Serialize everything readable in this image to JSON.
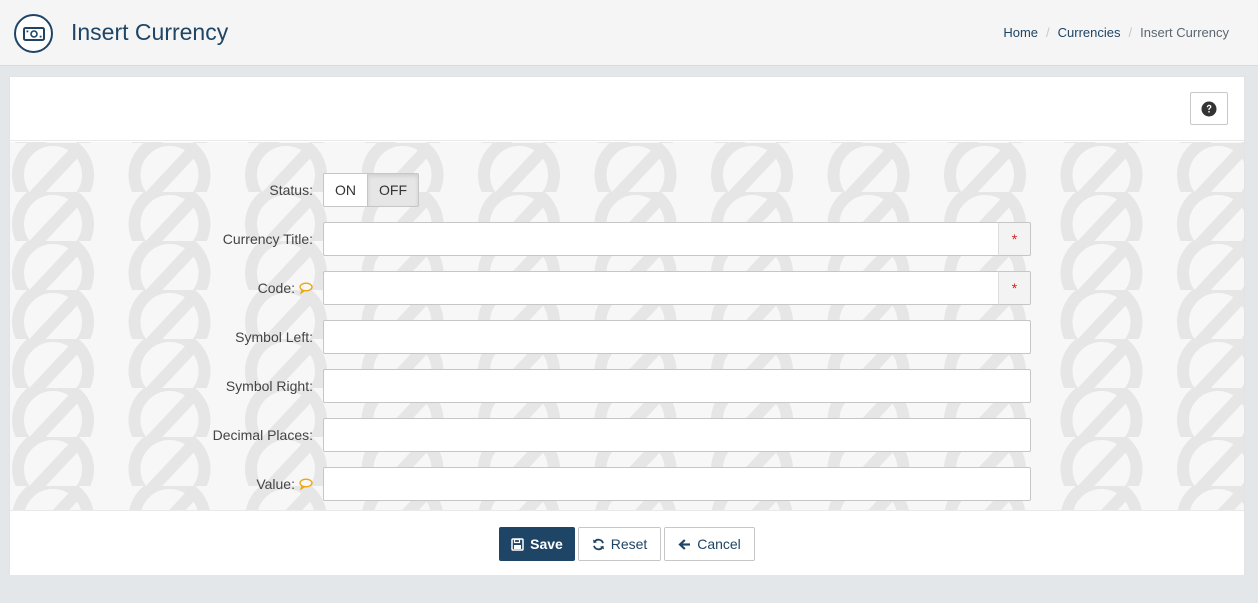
{
  "header": {
    "title": "Insert Currency",
    "icon": "money-bill-icon",
    "breadcrumb": [
      "Home",
      "Currencies",
      "Insert Currency"
    ]
  },
  "toolbar": {
    "help_icon": "question-circle-icon"
  },
  "form": {
    "status": {
      "label": "Status:",
      "on_label": "ON",
      "off_label": "OFF",
      "selected": "OFF"
    },
    "currency_title": {
      "label": "Currency Title:",
      "value": "",
      "required_mark": "*"
    },
    "code": {
      "label": "Code:",
      "value": "",
      "required_mark": "*",
      "tip_icon": "comment-icon"
    },
    "symbol_left": {
      "label": "Symbol Left:",
      "value": ""
    },
    "symbol_right": {
      "label": "Symbol Right:",
      "value": ""
    },
    "decimal_places": {
      "label": "Decimal Places:",
      "value": ""
    },
    "value": {
      "label": "Value:",
      "value": "",
      "tip_icon": "comment-icon"
    }
  },
  "buttons": {
    "save": "Save",
    "reset": "Reset",
    "cancel": "Cancel"
  },
  "colors": {
    "primary": "#1e4566",
    "required": "#d9231d",
    "tip": "#f0a30a"
  }
}
